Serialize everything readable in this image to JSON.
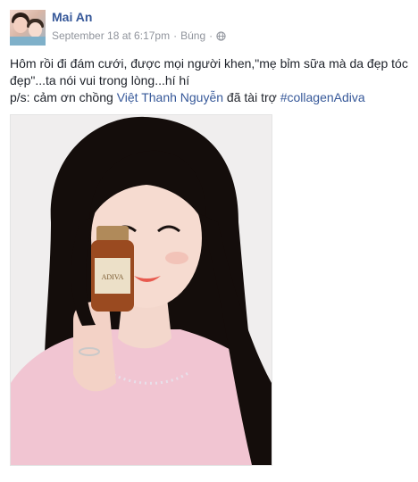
{
  "post": {
    "author_name": "Mai An",
    "timestamp": "September 18 at 6:17pm",
    "separator": "·",
    "location": "Búng",
    "privacy_icon": "globe-icon",
    "text": {
      "line1": "Hôm rồi đi đám cưới, được mọi người khen,\"mẹ bỉm sữa mà da đẹp tóc đẹp\"...ta nói vui trong lòng...hí hí",
      "line2_prefix": "p/s: cảm ơn chồng ",
      "line2_tag": "Việt Thanh Nguyễn",
      "line2_middle": " đã tài trợ ",
      "line2_hashtag": "#collagenAdiva"
    },
    "photo": {
      "bottle_label": "ADIVA"
    }
  },
  "colors": {
    "link": "#365899",
    "meta": "#90949c",
    "text": "#1d2129"
  }
}
